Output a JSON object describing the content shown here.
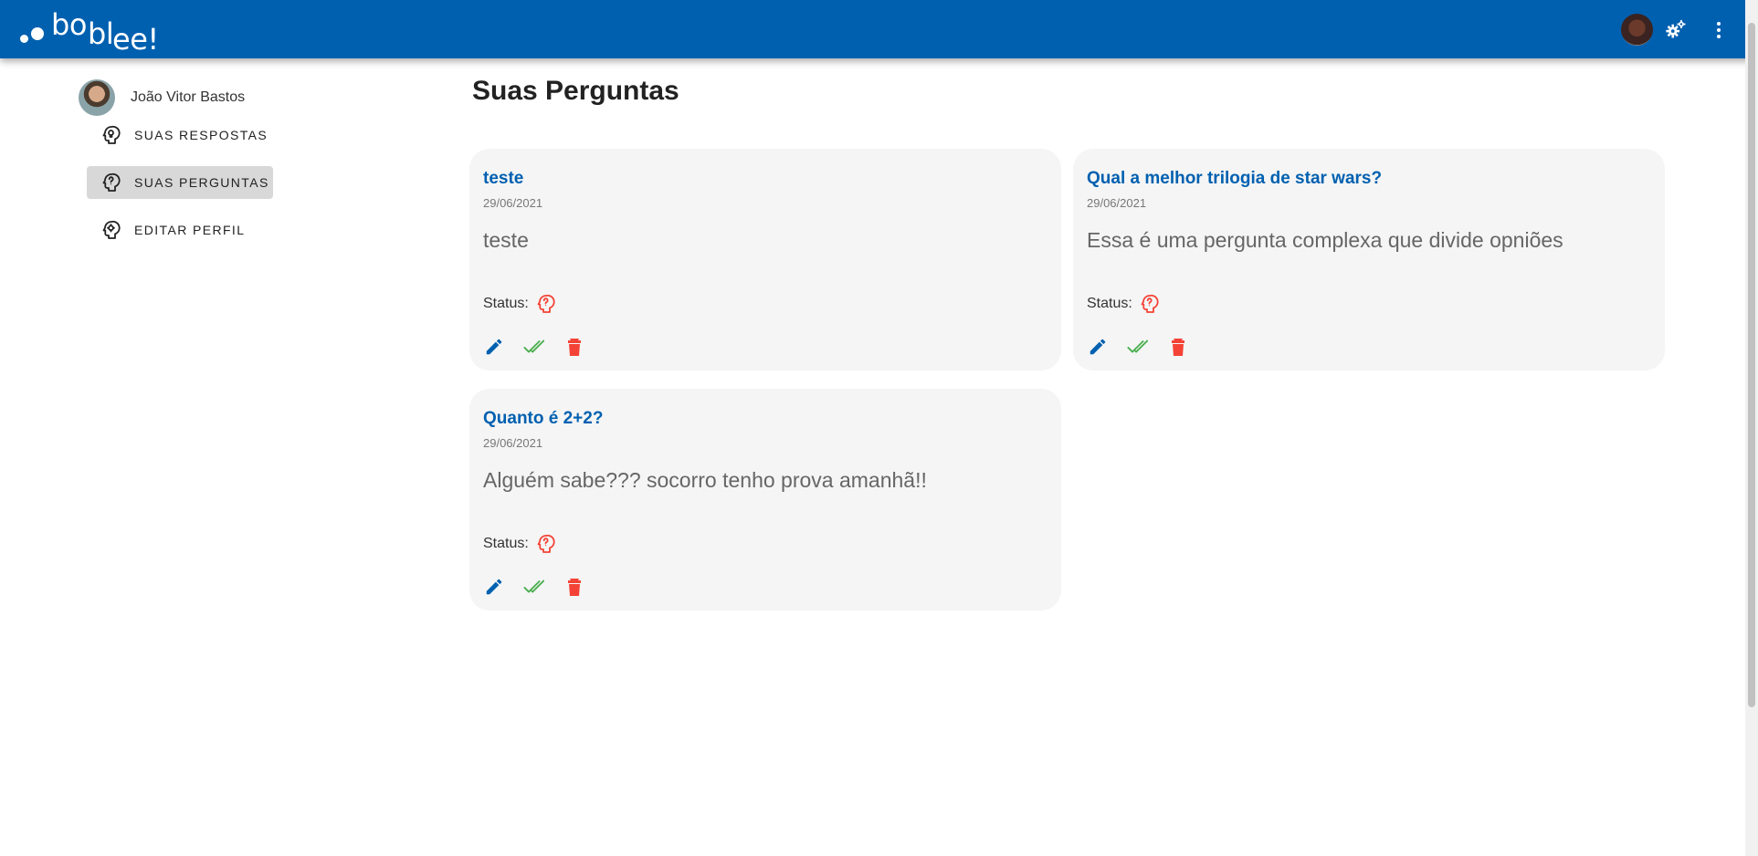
{
  "app": {
    "logo_text": "boblee!",
    "logo_parts": [
      "bo",
      "bl",
      "ee!"
    ]
  },
  "colors": {
    "header": "#0060b0",
    "accent": "#0060b0",
    "success": "#4caf50",
    "danger": "#f44336",
    "card_bg": "#f5f5f5"
  },
  "header": {
    "icons": [
      "avatar",
      "gear-icon",
      "more-vertical-icon"
    ]
  },
  "sidebar": {
    "user_name": "João Vitor Bastos",
    "items": [
      {
        "label": "SUAS RESPOSTAS",
        "icon": "lightbulb-head-icon",
        "active": false
      },
      {
        "label": "SUAS PERGUNTAS",
        "icon": "question-head-icon",
        "active": true
      },
      {
        "label": "EDITAR PERFIL",
        "icon": "gear-head-icon",
        "active": false
      }
    ]
  },
  "main": {
    "title": "Suas Perguntas",
    "status_label": "Status:",
    "questions": [
      {
        "title": "teste",
        "date": "29/06/2021",
        "body": "teste",
        "status_icon": "question-head-icon"
      },
      {
        "title": "Qual a melhor trilogia de star wars?",
        "date": "29/06/2021",
        "body": "Essa é uma pergunta complexa que divide opniões",
        "status_icon": "question-head-icon"
      },
      {
        "title": "Quanto é 2+2?",
        "date": "29/06/2021",
        "body": "Alguém sabe??? socorro tenho prova amanhã!!",
        "status_icon": "question-head-icon"
      }
    ],
    "action_icons": [
      "pencil-icon",
      "double-check-icon",
      "trash-icon"
    ]
  }
}
